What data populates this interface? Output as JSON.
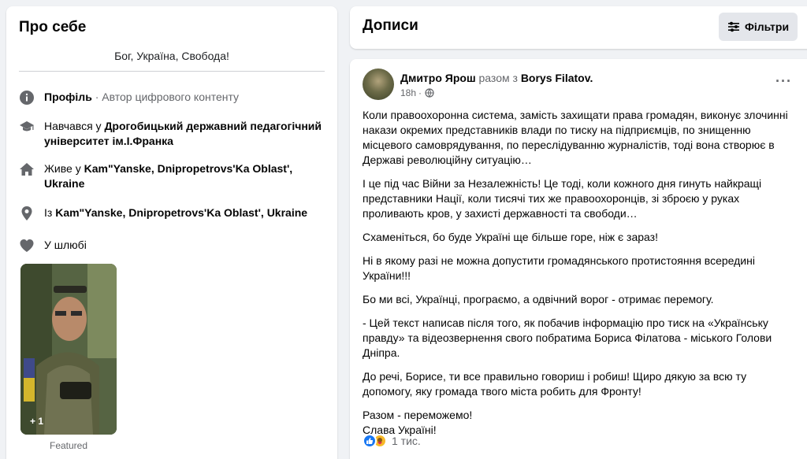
{
  "about": {
    "title": "Про себе",
    "bio": "Бог, Україна, Свобода!",
    "profile_label": "Профіль",
    "profile_text": " · Автор цифрового контенту",
    "study_prefix": "Навчався у ",
    "study_school": "Дрогобицький державний педагогічний університет ім.І.Франка",
    "lives_prefix": "Живе у ",
    "lives_place": "Kam\"Yanske, Dnipropetrovs'Ka Oblast', Ukraine",
    "from_prefix": "Із ",
    "from_place": "Kam\"Yanske, Dnipropetrovs'Ka Oblast', Ukraine",
    "relationship": "У шлюбі",
    "photo_count": "+ 1",
    "featured_label": "Featured"
  },
  "posts_header": {
    "title": "Дописи",
    "filters_label": "Фільтри"
  },
  "post": {
    "author": "Дмитро Ярош",
    "with_text": "разом з",
    "coauthor": "Borys Filatov.",
    "time": "18h",
    "more": "···",
    "paragraphs": [
      "Коли правоохоронна система, замість захищати права громадян, виконує злочинні накази окремих представників влади по тиску на підприємців, по знищенню місцевого самоврядування, по переслідуванню журналістів, тоді вона створює в Державі революційну ситуацію…",
      "І це під час Війни за Незалежність! Це тоді, коли кожного дня гинуть найкращі представники Нації, коли тисячі тих же правоохоронців, зі зброєю у руках проливають кров, у захисті державності та свободи…",
      "Схаменіться, бо буде Україні ще більше горе, ніж є зараз!",
      "Ні в якому разі не можна допустити громадянського протистояння всередині України!!!",
      "Бо ми всі, Українці, програємо, а одвічний ворог - отримає перемогу.",
      "- Цей текст написав після того, як побачив інформацію про тиск на «Українську правду» та відеозвернення свого побратима Бориса Філатова - міського Голови Дніпра.",
      "До речі, Борисе, ти все правильно говориш і робиш! Щиро дякую за всю ту допомогу, яку громада твого міста робить для Фронту!"
    ],
    "closing_1": "Разом - переможемо!",
    "closing_2": "Слава Україні!",
    "reactions_count": "1 тис."
  },
  "colors": {
    "page_bg": "#f0f2f5",
    "card_bg": "#ffffff",
    "muted_text": "#65676b",
    "icon_gray": "#65676b",
    "like_blue": "#1877f2",
    "button_bg": "#e4e6eb"
  },
  "icons": [
    "info-icon",
    "graduation-cap-icon",
    "home-icon",
    "location-pin-icon",
    "heart-icon",
    "filter-icon",
    "globe-icon",
    "like-icon",
    "care-icon"
  ]
}
